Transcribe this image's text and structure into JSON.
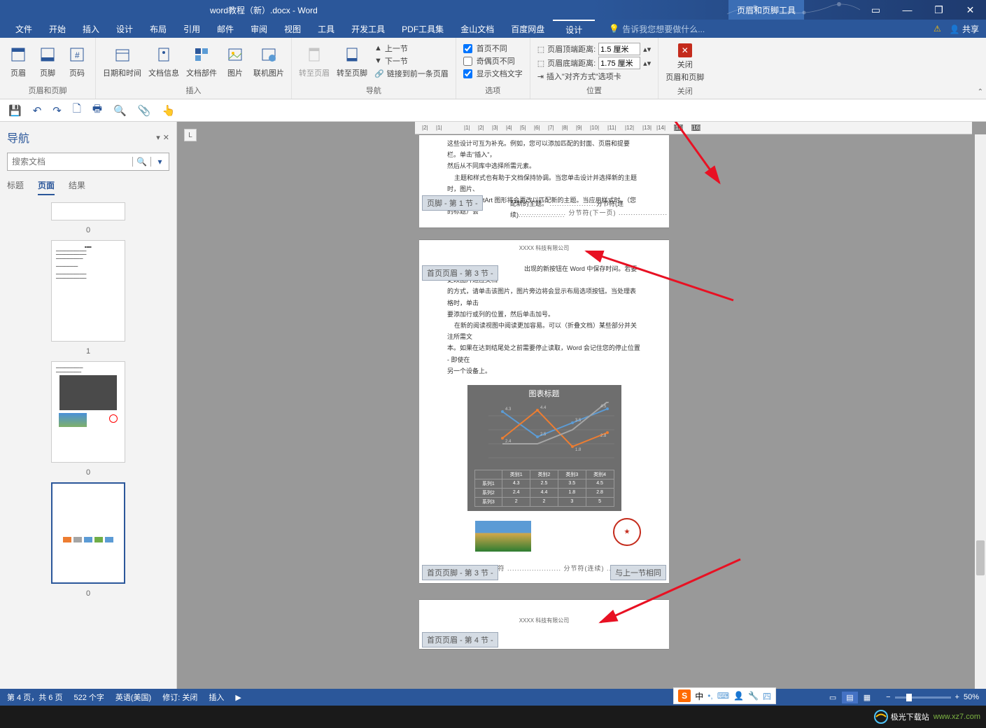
{
  "titlebar": {
    "doc_title": "word教程（新）.docx - Word",
    "tool_tab": "页眉和页脚工具",
    "win": {
      "help": "?",
      "min": "—",
      "restore": "❐",
      "close": "✕",
      "ribbon_opts": "▭"
    }
  },
  "menu": {
    "tabs": [
      "文件",
      "开始",
      "插入",
      "设计",
      "布局",
      "引用",
      "邮件",
      "审阅",
      "视图",
      "工具",
      "开发工具",
      "PDF工具集",
      "金山文档",
      "百度网盘",
      "设计"
    ],
    "active_index": 14,
    "tell_me": "告诉我您想要做什么...",
    "share": "共享"
  },
  "ribbon": {
    "g1": {
      "label": "页眉和页脚",
      "header": "页眉",
      "footer": "页脚",
      "pagenum": "页码"
    },
    "g2": {
      "label": "插入",
      "datetime": "日期和时间",
      "docinfo": "文档信息",
      "docparts": "文档部件",
      "picture": "图片",
      "onlinepic": "联机图片"
    },
    "g3": {
      "label": "导航",
      "goto_header": "转至页眉",
      "goto_footer": "转至页脚",
      "prev": "上一节",
      "next": "下一节",
      "link_prev": "链接到前一条页眉"
    },
    "g4": {
      "label": "选项",
      "first_diff": "首页不同",
      "odd_even": "奇偶页不同",
      "show_doc": "显示文档文字"
    },
    "g5": {
      "label": "位置",
      "header_top": "页眉顶端距离:",
      "header_top_val": "1.5 厘米",
      "footer_bottom": "页眉底端距离:",
      "footer_bottom_val": "1.75 厘米",
      "align_tab": "插入\"对齐方式\"选项卡"
    },
    "g6": {
      "label": "关闭",
      "close1": "关闭",
      "close2": "页眉和页脚"
    }
  },
  "nav": {
    "title": "导航",
    "search_placeholder": "搜索文档",
    "tabs": [
      "标题",
      "页面",
      "结果"
    ],
    "active_tab": 1,
    "thumbs": [
      "0",
      "1",
      "0",
      "0"
    ]
  },
  "doc": {
    "footer_tag_1": "页脚 - 第 1 节 -",
    "header_tag_3": "首页页眉 - 第 3 节 -",
    "footer_tag_3": "首页页脚 - 第 3 节 -",
    "same_as_prev": "与上一节相同",
    "header_tag_4": "首页页眉 - 第 4 节 -",
    "company": "XXXX 科技有限公司",
    "p1_l1": "这些设计可互为补充。例如，您可以添加匹配的封面、页眉和提要栏。单击\"插入\"，",
    "p1_l2": "然后从不同库中选择所需元素。",
    "p1_l3": "主题和样式也有助于文档保持协调。当您单击设计并选择新的主题时，图片、",
    "p1_l4": "图表或 SmartArt 图形将会更改以匹配新的主题。当应用样式时，（您的标题）会",
    "p1_break1": "分节符(连续)",
    "p1_l5": "配新的主题。",
    "p1_break2": "分节符(下一页)",
    "p3_l1": "出现的新按钮在 Word 中保存时间。若要更改图片适应文档",
    "p3_l2": "的方式，请单击该图片，图片旁边将会显示布局选项按钮。当处理表格时，单击",
    "p3_l3": "要添加行或列的位置，然后单击加号。",
    "p3_l4": "在新的阅读视图中阅读更加容易。可以（折叠文档）某些部分并关注所需文",
    "p3_l5": "本。如果在达到结尾处之前需要停止读取，Word 会记住您的停止位置 - 即使在",
    "p3_l6": "另一个设备上。",
    "p3_break": "分页符",
    "p3_break2": "分节符(连续)",
    "ruler_marks": [
      "2",
      "1",
      "1",
      "2",
      "3",
      "4",
      "5",
      "6",
      "7",
      "8",
      "9",
      "10",
      "11",
      "12",
      "13",
      "14",
      "15",
      "16"
    ]
  },
  "chart_data": {
    "type": "line",
    "title": "图表标题",
    "categories": [
      "类别1",
      "类别2",
      "类别3",
      "类别4"
    ],
    "series": [
      {
        "name": "系列1",
        "values": [
          4.3,
          2.5,
          3.5,
          4.5
        ]
      },
      {
        "name": "系列2",
        "values": [
          2.4,
          4.4,
          1.8,
          2.8
        ]
      },
      {
        "name": "系列3",
        "values": [
          2,
          2,
          3,
          5
        ]
      }
    ],
    "ylim": [
      0,
      6
    ]
  },
  "status": {
    "page": "第 4 页，共 6 页",
    "words": "522 个字",
    "lang": "英语(美国)",
    "track": "修订: 关闭",
    "insert": "插入",
    "zoom": "50%"
  },
  "watermark": {
    "site1": "极光下载站",
    "site2": "www.xz7.com"
  },
  "ime": {
    "label": "中"
  }
}
